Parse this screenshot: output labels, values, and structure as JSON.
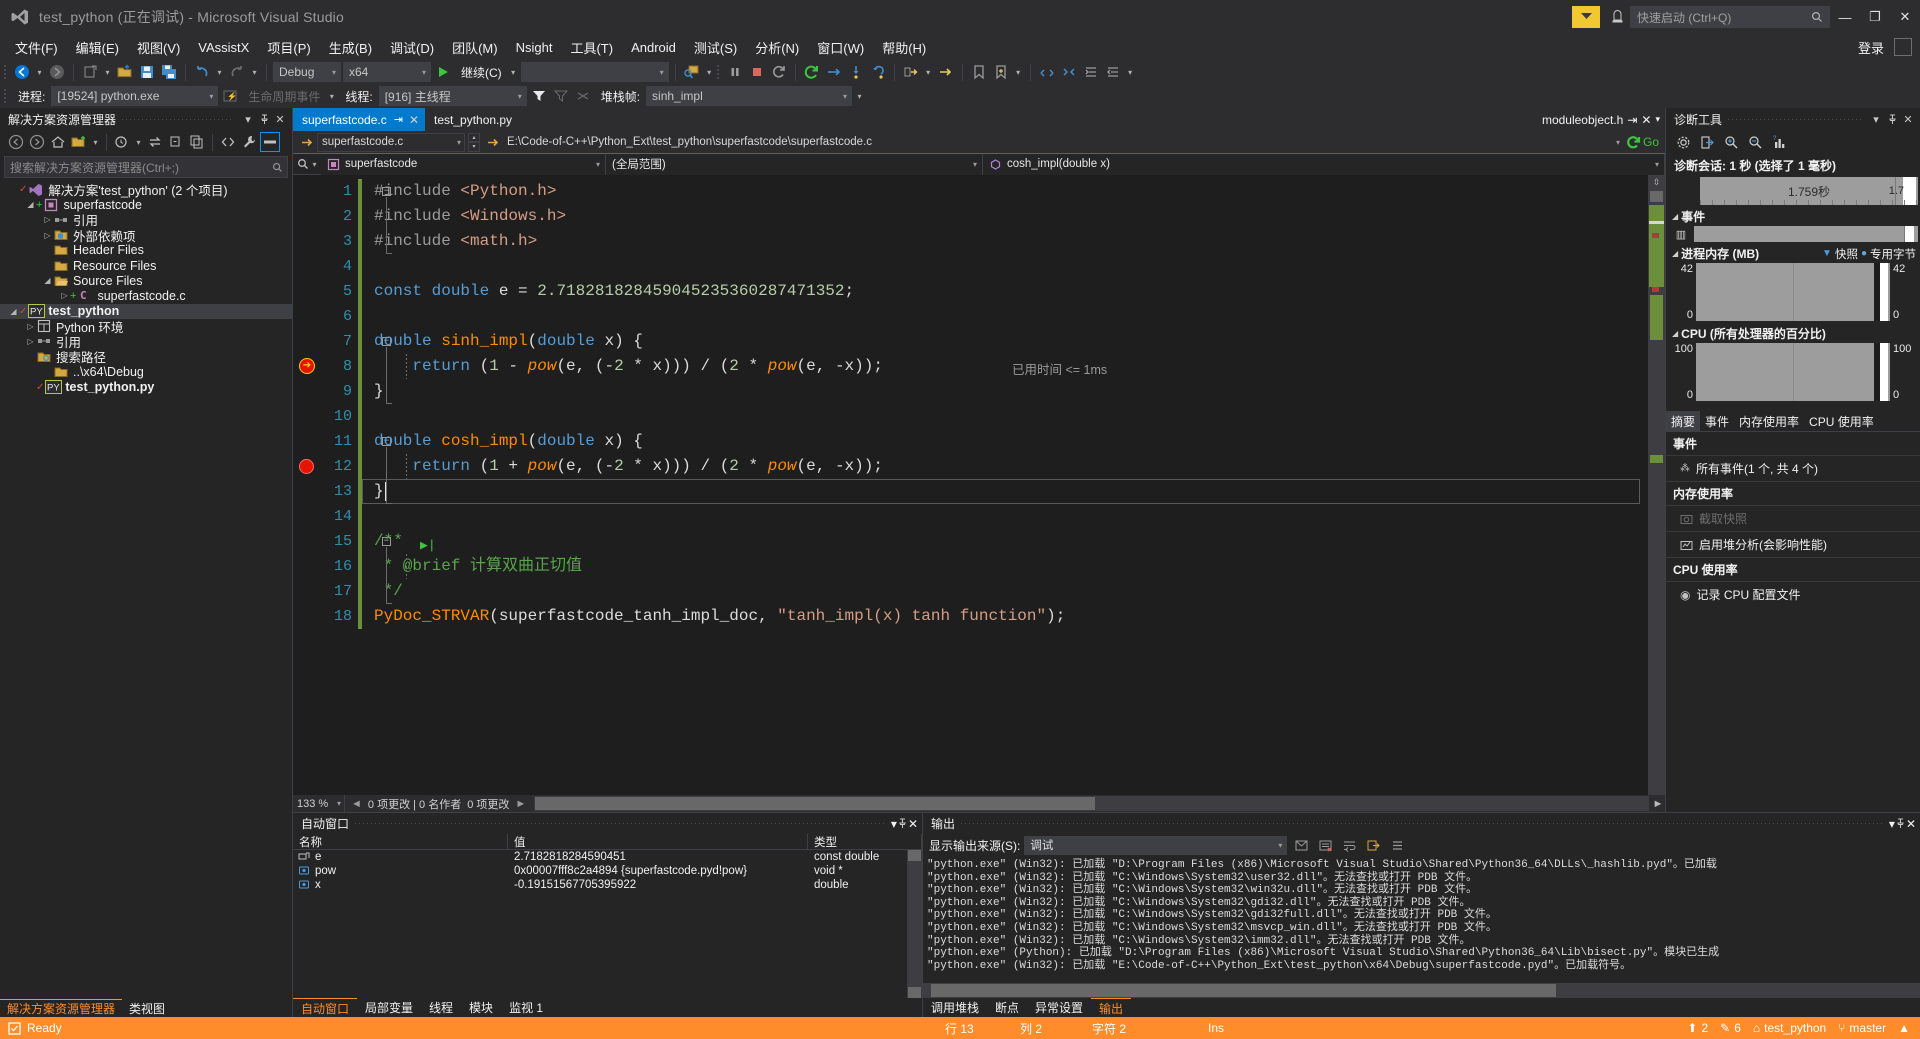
{
  "window": {
    "title": "test_python (正在调试) - Microsoft Visual Studio",
    "quick_launch_placeholder": "快速启动 (Ctrl+Q)",
    "signin": "登录",
    "minimize": "—",
    "maximize": "❐",
    "close": "✕"
  },
  "menu": {
    "items": [
      {
        "label": "文件(F)"
      },
      {
        "label": "编辑(E)"
      },
      {
        "label": "视图(V)"
      },
      {
        "label": "VAssistX"
      },
      {
        "label": "项目(P)"
      },
      {
        "label": "生成(B)"
      },
      {
        "label": "调试(D)"
      },
      {
        "label": "团队(M)"
      },
      {
        "label": "Nsight"
      },
      {
        "label": "工具(T)"
      },
      {
        "label": "Android"
      },
      {
        "label": "测试(S)"
      },
      {
        "label": "分析(N)"
      },
      {
        "label": "窗口(W)"
      },
      {
        "label": "帮助(H)"
      }
    ]
  },
  "toolbar": {
    "config": "Debug",
    "platform": "x64",
    "continue_label": "继续(C)",
    "empty_combo": ""
  },
  "debugbar": {
    "process_label": "进程:",
    "process_value": "[19524] python.exe",
    "lifecycle_label": "生命周期事件",
    "thread_label": "线程:",
    "thread_value": "[916] 主线程",
    "stackframe_label": "堆栈帧:",
    "stackframe_value": "sinh_impl"
  },
  "solution_explorer": {
    "title": "解决方案资源管理器",
    "search_placeholder": "搜索解决方案资源管理器(Ctrl+;)",
    "tree": [
      {
        "depth": 0,
        "twist": "",
        "icon": "solution-icon",
        "label": "解决方案'test_python' (2 个项目)",
        "check": true,
        "bold": false,
        "selected": false
      },
      {
        "depth": 1,
        "twist": "open",
        "icon": "cproject-icon",
        "label": "superfastcode",
        "plus": true,
        "bold": false,
        "selected": false
      },
      {
        "depth": 2,
        "twist": "closed",
        "icon": "references-icon",
        "label": "引用",
        "bold": false,
        "selected": false
      },
      {
        "depth": 2,
        "twist": "closed",
        "icon": "externaldeps-icon",
        "label": "外部依赖项",
        "bold": false,
        "selected": false
      },
      {
        "depth": 2,
        "twist": "",
        "icon": "folder-icon",
        "label": "Header Files",
        "bold": false,
        "selected": false
      },
      {
        "depth": 2,
        "twist": "",
        "icon": "folder-icon",
        "label": "Resource Files",
        "bold": false,
        "selected": false
      },
      {
        "depth": 2,
        "twist": "open",
        "icon": "folder-open-icon",
        "label": "Source Files",
        "bold": false,
        "selected": false
      },
      {
        "depth": 3,
        "twist": "closed",
        "icon": "c-file-icon",
        "label": "superfastcode.c",
        "plus": true,
        "bold": false,
        "selected": false
      },
      {
        "depth": 0,
        "twist": "open",
        "icon": "py-project-icon",
        "label": "test_python",
        "check": true,
        "bold": true,
        "selected": true
      },
      {
        "depth": 1,
        "twist": "closed",
        "icon": "pyenv-icon",
        "label": "Python 环境",
        "bold": false,
        "selected": false
      },
      {
        "depth": 1,
        "twist": "closed",
        "icon": "references-icon",
        "label": "引用",
        "bold": false,
        "selected": false
      },
      {
        "depth": 1,
        "twist": "",
        "icon": "searchpath-icon",
        "label": "搜索路径",
        "bold": false,
        "selected": false
      },
      {
        "depth": 2,
        "twist": "",
        "icon": "path-icon",
        "label": "..\\x64\\Debug",
        "bold": false,
        "selected": false
      },
      {
        "depth": 1,
        "twist": "",
        "icon": "py-file-icon",
        "label": "test_python.py",
        "check": true,
        "bold": true,
        "selected": false
      }
    ],
    "tabs": [
      {
        "label": "解决方案资源管理器",
        "active": true
      },
      {
        "label": "类视图",
        "active": false
      }
    ]
  },
  "document_tabs": [
    {
      "label": "superfastcode.c",
      "active": true,
      "pinned": true,
      "closable": true
    },
    {
      "label": "test_python.py",
      "active": false,
      "pinned": false,
      "closable": false
    },
    {
      "label": "moduleobject.h",
      "active": false,
      "pinned": true,
      "closable": true
    }
  ],
  "navbar": {
    "file_combo": "superfastcode.c",
    "path": "E:\\Code-of-C++\\Python_Ext\\test_python\\superfastcode\\superfastcode.c",
    "go_label": "Go",
    "project_combo": "superfastcode",
    "scope_combo": "(全局范围)",
    "member_combo": "cosh_impl(double x)"
  },
  "editor": {
    "lines": [
      {
        "n": 1,
        "fold": "minus",
        "text": "#include <Python.h>"
      },
      {
        "n": 2,
        "fold": "",
        "text": "#include <Windows.h>"
      },
      {
        "n": 3,
        "fold": "",
        "text": "#include <math.h>"
      },
      {
        "n": 4,
        "fold": "",
        "text": ""
      },
      {
        "n": 5,
        "fold": "",
        "text": "const double e = 2.718281828459045235360287471352;"
      },
      {
        "n": 6,
        "fold": "",
        "text": ""
      },
      {
        "n": 7,
        "fold": "minus",
        "text": "double sinh_impl(double x) {"
      },
      {
        "n": 8,
        "fold": "",
        "text": "    return (1 - pow(e, (-2 * x))) / (2 * pow(e, -x));",
        "hint": "已用时间 <= 1ms",
        "breakpoint": "current"
      },
      {
        "n": 9,
        "fold": "",
        "text": "}"
      },
      {
        "n": 10,
        "fold": "",
        "text": ""
      },
      {
        "n": 11,
        "fold": "minus",
        "text": "double cosh_impl(double x) {"
      },
      {
        "n": 12,
        "fold": "",
        "text": "    return (1 + pow(e, (-2 * x))) / (2 * pow(e, -x));",
        "breakpoint": "normal"
      },
      {
        "n": 13,
        "fold": "",
        "text": "}",
        "caret": true
      },
      {
        "n": 14,
        "fold": "",
        "text": ""
      },
      {
        "n": 15,
        "fold": "minus",
        "text": "/**"
      },
      {
        "n": 16,
        "fold": "",
        "text": " * @brief 计算双曲正切值"
      },
      {
        "n": 17,
        "fold": "",
        "text": " */"
      },
      {
        "n": 18,
        "fold": "",
        "text": "PyDoc_STRVAR(superfastcode_tanh_impl_doc, \"tanh_impl(x) tanh function\");"
      }
    ],
    "zoom": "133 %",
    "changes_summary": "0 项更改 | 0 名作者",
    "changes_summary2": "0 项更改"
  },
  "diagnostics": {
    "title": "诊断工具",
    "session_label": "诊断会话: 1 秒 (选择了 1 毫秒)",
    "timeline_value": "1.759秒",
    "timeline_end": "1.7",
    "events_section": "事件",
    "memory_section": "进程内存 (MB)",
    "memory_legend_snapshot": "快照",
    "memory_legend_private": "专用字节",
    "memory_max": "42",
    "memory_min": "0",
    "cpu_section": "CPU (所有处理器的百分比)",
    "cpu_max": "100",
    "cpu_min": "0",
    "tabs": [
      {
        "label": "摘要",
        "active": true
      },
      {
        "label": "事件",
        "active": false
      },
      {
        "label": "内存使用率",
        "active": false
      },
      {
        "label": "CPU 使用率",
        "active": false
      }
    ],
    "summary": {
      "events_heading": "事件",
      "events_row": "所有事件(1 个, 共 4 个)",
      "memory_heading": "内存使用率",
      "memory_rows": [
        {
          "label": "截取快照",
          "disabled": true
        },
        {
          "label": "启用堆分析(会影响性能)",
          "disabled": false
        }
      ],
      "cpu_heading": "CPU 使用率",
      "cpu_rows": [
        {
          "label": "记录 CPU 配置文件",
          "disabled": false
        }
      ]
    }
  },
  "autos": {
    "title": "自动窗口",
    "columns": [
      "名称",
      "值",
      "类型"
    ],
    "rows": [
      {
        "name": "e",
        "value": "2.7182818284590451",
        "type": "const double",
        "icon": "field-icon"
      },
      {
        "name": "pow",
        "value": "0x00007fff8c2a4894 {superfastcode.pyd!pow}",
        "type": "void *",
        "icon": "var-icon"
      },
      {
        "name": "x",
        "value": "-0.19151567705395922",
        "type": "double",
        "icon": "var-icon"
      }
    ],
    "tabs": [
      {
        "label": "自动窗口",
        "active": true
      },
      {
        "label": "局部变量",
        "active": false
      },
      {
        "label": "线程",
        "active": false
      },
      {
        "label": "模块",
        "active": false
      },
      {
        "label": "监视 1",
        "active": false
      }
    ]
  },
  "output": {
    "title": "输出",
    "source_label": "显示输出来源(S):",
    "source_value": "调试",
    "lines": [
      "\"python.exe\" (Win32): 已加载 \"D:\\Program Files (x86)\\Microsoft Visual Studio\\Shared\\Python36_64\\DLLs\\_hashlib.pyd\"。已加载",
      "\"python.exe\" (Win32): 已加载 \"C:\\Windows\\System32\\user32.dll\"。无法查找或打开 PDB 文件。",
      "\"python.exe\" (Win32): 已加载 \"C:\\Windows\\System32\\win32u.dll\"。无法查找或打开 PDB 文件。",
      "\"python.exe\" (Win32): 已加载 \"C:\\Windows\\System32\\gdi32.dll\"。无法查找或打开 PDB 文件。",
      "\"python.exe\" (Win32): 已加载 \"C:\\Windows\\System32\\gdi32full.dll\"。无法查找或打开 PDB 文件。",
      "\"python.exe\" (Win32): 已加载 \"C:\\Windows\\System32\\msvcp_win.dll\"。无法查找或打开 PDB 文件。",
      "\"python.exe\" (Win32): 已加载 \"C:\\Windows\\System32\\imm32.dll\"。无法查找或打开 PDB 文件。",
      "\"python.exe\" (Python): 已加载 \"D:\\Program Files (x86)\\Microsoft Visual Studio\\Shared\\Python36_64\\Lib\\bisect.py\"。模块已生成",
      "\"python.exe\" (Win32): 已加载 \"E:\\Code-of-C++\\Python_Ext\\test_python\\x64\\Debug\\superfastcode.pyd\"。已加载符号。"
    ],
    "tabs": [
      {
        "label": "调用堆栈",
        "active": false
      },
      {
        "label": "断点",
        "active": false
      },
      {
        "label": "异常设置",
        "active": false
      },
      {
        "label": "输出",
        "active": true
      }
    ]
  },
  "statusbar": {
    "ready": "Ready",
    "row_label": "行 13",
    "col_label": "列 2",
    "char_label": "字符 2",
    "ins_label": "Ins",
    "up_count": "2",
    "pencil_count": "6",
    "project": "test_python",
    "branch": "master"
  },
  "colors": {
    "accent_blue": "#007acc",
    "debug_orange": "#ff8c2b",
    "breakpoint_red": "#e51400",
    "current_yellow": "#ffd700",
    "tab_active": "#007acc"
  }
}
